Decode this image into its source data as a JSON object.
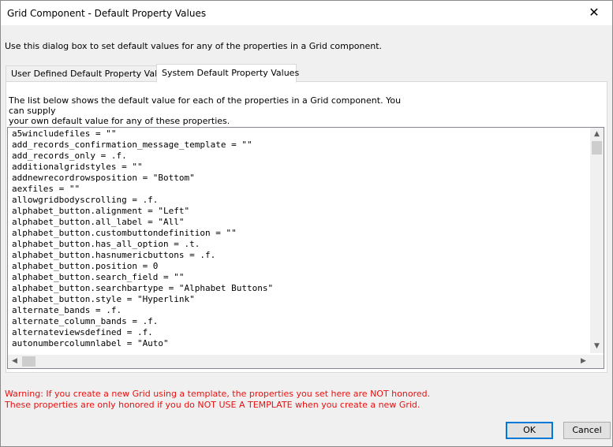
{
  "window": {
    "title": "Grid Component - Default Property Values"
  },
  "intro": "Use this dialog box to set default values for any of the properties in a Grid component.",
  "tabs": [
    {
      "label": "User Defined Default Property Values"
    },
    {
      "label": "System Default Property Values"
    }
  ],
  "panel": {
    "description_line1": "The list below shows the default value for each of the properties in a Grid component. You can supply",
    "description_line2": "your own default value for any of these properties."
  },
  "properties": [
    "a5wincludefiles = \"\"",
    "add_records_confirmation_message_template = \"\"",
    "add_records_only = .f.",
    "additionalgridstyles = \"\"",
    "addnewrecordrowsposition = \"Bottom\"",
    "aexfiles = \"\"",
    "allowgridbodyscrolling = .f.",
    "alphabet_button.alignment = \"Left\"",
    "alphabet_button.all_label = \"All\"",
    "alphabet_button.custombuttondefinition = \"\"",
    "alphabet_button.has_all_option = .t.",
    "alphabet_button.hasnumericbuttons = .f.",
    "alphabet_button.position = 0",
    "alphabet_button.search_field = \"\"",
    "alphabet_button.searchbartype = \"Alphabet Buttons\"",
    "alphabet_button.style = \"Hyperlink\"",
    "alternate_bands = .f.",
    "alternate_column_bands = .f.",
    "alternateviewsdefined = .f.",
    "autonumbercolumnlabel = \"Auto\""
  ],
  "warning": {
    "line1": "Warning: If you create a new Grid using a template, the properties you set here are NOT honored.",
    "line2": "These properties are only honored if you do NOT USE A TEMPLATE when you create a new Grid."
  },
  "buttons": {
    "ok": "OK",
    "cancel": "Cancel"
  },
  "colors": {
    "warning": "#e81010",
    "focus_border": "#0078d7"
  }
}
